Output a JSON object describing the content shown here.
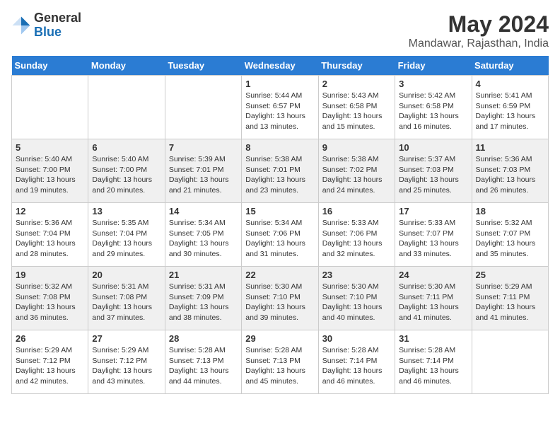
{
  "header": {
    "logo_general": "General",
    "logo_blue": "Blue",
    "main_title": "May 2024",
    "subtitle": "Mandawar, Rajasthan, India"
  },
  "calendar": {
    "days_of_week": [
      "Sunday",
      "Monday",
      "Tuesday",
      "Wednesday",
      "Thursday",
      "Friday",
      "Saturday"
    ],
    "weeks": [
      {
        "id": "week1",
        "cells": [
          {
            "day": "",
            "info": ""
          },
          {
            "day": "",
            "info": ""
          },
          {
            "day": "",
            "info": ""
          },
          {
            "day": "1",
            "info": "Sunrise: 5:44 AM\nSunset: 6:57 PM\nDaylight: 13 hours\nand 13 minutes."
          },
          {
            "day": "2",
            "info": "Sunrise: 5:43 AM\nSunset: 6:58 PM\nDaylight: 13 hours\nand 15 minutes."
          },
          {
            "day": "3",
            "info": "Sunrise: 5:42 AM\nSunset: 6:58 PM\nDaylight: 13 hours\nand 16 minutes."
          },
          {
            "day": "4",
            "info": "Sunrise: 5:41 AM\nSunset: 6:59 PM\nDaylight: 13 hours\nand 17 minutes."
          }
        ]
      },
      {
        "id": "week2",
        "cells": [
          {
            "day": "5",
            "info": "Sunrise: 5:40 AM\nSunset: 7:00 PM\nDaylight: 13 hours\nand 19 minutes."
          },
          {
            "day": "6",
            "info": "Sunrise: 5:40 AM\nSunset: 7:00 PM\nDaylight: 13 hours\nand 20 minutes."
          },
          {
            "day": "7",
            "info": "Sunrise: 5:39 AM\nSunset: 7:01 PM\nDaylight: 13 hours\nand 21 minutes."
          },
          {
            "day": "8",
            "info": "Sunrise: 5:38 AM\nSunset: 7:01 PM\nDaylight: 13 hours\nand 23 minutes."
          },
          {
            "day": "9",
            "info": "Sunrise: 5:38 AM\nSunset: 7:02 PM\nDaylight: 13 hours\nand 24 minutes."
          },
          {
            "day": "10",
            "info": "Sunrise: 5:37 AM\nSunset: 7:03 PM\nDaylight: 13 hours\nand 25 minutes."
          },
          {
            "day": "11",
            "info": "Sunrise: 5:36 AM\nSunset: 7:03 PM\nDaylight: 13 hours\nand 26 minutes."
          }
        ]
      },
      {
        "id": "week3",
        "cells": [
          {
            "day": "12",
            "info": "Sunrise: 5:36 AM\nSunset: 7:04 PM\nDaylight: 13 hours\nand 28 minutes."
          },
          {
            "day": "13",
            "info": "Sunrise: 5:35 AM\nSunset: 7:04 PM\nDaylight: 13 hours\nand 29 minutes."
          },
          {
            "day": "14",
            "info": "Sunrise: 5:34 AM\nSunset: 7:05 PM\nDaylight: 13 hours\nand 30 minutes."
          },
          {
            "day": "15",
            "info": "Sunrise: 5:34 AM\nSunset: 7:06 PM\nDaylight: 13 hours\nand 31 minutes."
          },
          {
            "day": "16",
            "info": "Sunrise: 5:33 AM\nSunset: 7:06 PM\nDaylight: 13 hours\nand 32 minutes."
          },
          {
            "day": "17",
            "info": "Sunrise: 5:33 AM\nSunset: 7:07 PM\nDaylight: 13 hours\nand 33 minutes."
          },
          {
            "day": "18",
            "info": "Sunrise: 5:32 AM\nSunset: 7:07 PM\nDaylight: 13 hours\nand 35 minutes."
          }
        ]
      },
      {
        "id": "week4",
        "cells": [
          {
            "day": "19",
            "info": "Sunrise: 5:32 AM\nSunset: 7:08 PM\nDaylight: 13 hours\nand 36 minutes."
          },
          {
            "day": "20",
            "info": "Sunrise: 5:31 AM\nSunset: 7:08 PM\nDaylight: 13 hours\nand 37 minutes."
          },
          {
            "day": "21",
            "info": "Sunrise: 5:31 AM\nSunset: 7:09 PM\nDaylight: 13 hours\nand 38 minutes."
          },
          {
            "day": "22",
            "info": "Sunrise: 5:30 AM\nSunset: 7:10 PM\nDaylight: 13 hours\nand 39 minutes."
          },
          {
            "day": "23",
            "info": "Sunrise: 5:30 AM\nSunset: 7:10 PM\nDaylight: 13 hours\nand 40 minutes."
          },
          {
            "day": "24",
            "info": "Sunrise: 5:30 AM\nSunset: 7:11 PM\nDaylight: 13 hours\nand 41 minutes."
          },
          {
            "day": "25",
            "info": "Sunrise: 5:29 AM\nSunset: 7:11 PM\nDaylight: 13 hours\nand 41 minutes."
          }
        ]
      },
      {
        "id": "week5",
        "cells": [
          {
            "day": "26",
            "info": "Sunrise: 5:29 AM\nSunset: 7:12 PM\nDaylight: 13 hours\nand 42 minutes."
          },
          {
            "day": "27",
            "info": "Sunrise: 5:29 AM\nSunset: 7:12 PM\nDaylight: 13 hours\nand 43 minutes."
          },
          {
            "day": "28",
            "info": "Sunrise: 5:28 AM\nSunset: 7:13 PM\nDaylight: 13 hours\nand 44 minutes."
          },
          {
            "day": "29",
            "info": "Sunrise: 5:28 AM\nSunset: 7:13 PM\nDaylight: 13 hours\nand 45 minutes."
          },
          {
            "day": "30",
            "info": "Sunrise: 5:28 AM\nSunset: 7:14 PM\nDaylight: 13 hours\nand 46 minutes."
          },
          {
            "day": "31",
            "info": "Sunrise: 5:28 AM\nSunset: 7:14 PM\nDaylight: 13 hours\nand 46 minutes."
          },
          {
            "day": "",
            "info": ""
          }
        ]
      }
    ]
  }
}
